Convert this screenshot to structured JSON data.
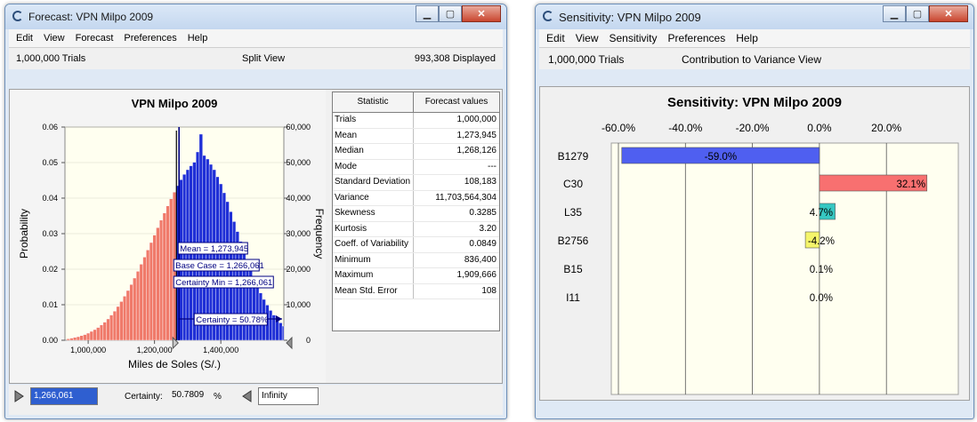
{
  "left": {
    "title": "Forecast: VPN Milpo 2009",
    "menu": [
      "Edit",
      "View",
      "Forecast",
      "Preferences",
      "Help"
    ],
    "trials_label": "1,000,000 Trials",
    "view_label": "Split View",
    "displayed_label": "993,308 Displayed",
    "chart_title": "VPN Milpo 2009",
    "xlabel": "Miles de Soles (S/.)",
    "ylabel_left": "Probability",
    "ylabel_right": "Frequency",
    "y_ticks_left": [
      "0.00",
      "0.01",
      "0.02",
      "0.03",
      "0.04",
      "0.05",
      "0.06"
    ],
    "y_ticks_right": [
      "0",
      "10,000",
      "20,000",
      "30,000",
      "40,000",
      "50,000",
      "60,000"
    ],
    "x_ticks": [
      "1,000,000",
      "1,200,000",
      "1,400,000"
    ],
    "annotations": {
      "mean": "Mean = 1,273,945",
      "base_case": "Base Case = 1,266,061",
      "certainty_min": "Certainty Min = 1,266,061",
      "certainty": "Certainty = 50.78%"
    },
    "stats_header": {
      "name": "Statistic",
      "value": "Forecast values"
    },
    "stats": [
      {
        "name": "Trials",
        "value": "1,000,000"
      },
      {
        "name": "Mean",
        "value": "1,273,945"
      },
      {
        "name": "Median",
        "value": "1,268,126"
      },
      {
        "name": "Mode",
        "value": "---"
      },
      {
        "name": "Standard Deviation",
        "value": "108,183"
      },
      {
        "name": "Variance",
        "value": "11,703,564,304"
      },
      {
        "name": "Skewness",
        "value": "0.3285"
      },
      {
        "name": "Kurtosis",
        "value": "3.20"
      },
      {
        "name": "Coeff. of Variability",
        "value": "0.0849"
      },
      {
        "name": "Minimum",
        "value": "836,400"
      },
      {
        "name": "Maximum",
        "value": "1,909,666"
      },
      {
        "name": "Mean Std. Error",
        "value": "108"
      }
    ],
    "bottom": {
      "lower_value": "1,266,061",
      "certainty_label": "Certainty:",
      "certainty_value": "50.7809",
      "percent": "%",
      "upper_value": "Infinity"
    },
    "colors": {
      "left_tail": "#f07a6a",
      "right_tail": "#1f2fd6",
      "plot_bg": "#fffff0"
    }
  },
  "right": {
    "title": "Sensitivity: VPN Milpo 2009",
    "menu": [
      "Edit",
      "View",
      "Sensitivity",
      "Preferences",
      "Help"
    ],
    "trials_label": "1,000,000 Trials",
    "view_label": "Contribution to Variance View",
    "chart_title": "Sensitivity: VPN Milpo 2009",
    "x_ticks": [
      "-60.0%",
      "-40.0%",
      "-20.0%",
      "0.0%",
      "20.0%"
    ]
  },
  "chart_data": [
    {
      "type": "bar",
      "title": "VPN Milpo 2009",
      "xlabel": "Miles de Soles (S/.)",
      "ylabel": "Probability",
      "xlim": [
        930000,
        1590000
      ],
      "ylim": [
        0,
        0.06
      ],
      "y2lim": [
        0,
        60000
      ],
      "certainty_min": 1266061,
      "mean": 1273945,
      "x_start": 935000,
      "bin_width": 10000,
      "values": [
        0.0004,
        0.0006,
        0.0008,
        0.001,
        0.0013,
        0.0016,
        0.002,
        0.0025,
        0.003,
        0.0036,
        0.0043,
        0.0051,
        0.006,
        0.0071,
        0.0082,
        0.0095,
        0.0109,
        0.0124,
        0.014,
        0.0157,
        0.0175,
        0.0194,
        0.0214,
        0.0234,
        0.0254,
        0.0275,
        0.0296,
        0.0317,
        0.0338,
        0.0358,
        0.0378,
        0.0398,
        0.0417,
        0.0435,
        0.0452,
        0.0467,
        0.048,
        0.0491,
        0.0501,
        0.053,
        0.058,
        0.052,
        0.051,
        0.0495,
        0.048,
        0.046,
        0.044,
        0.0415,
        0.039,
        0.0362,
        0.0334,
        0.0306,
        0.0278,
        0.025,
        0.0223,
        0.0198,
        0.0175,
        0.0153,
        0.0133,
        0.0115,
        0.0099,
        0.0084,
        0.0071,
        0.0059,
        0.0049,
        0.004
      ]
    },
    {
      "type": "bar",
      "orientation": "horizontal",
      "title": "Sensitivity: VPN Milpo 2009",
      "categories": [
        "B1279",
        "C30",
        "L35",
        "B2756",
        "B15",
        "I11"
      ],
      "values": [
        -59.0,
        32.1,
        4.7,
        -4.2,
        0.1,
        0.0
      ],
      "labels": [
        "-59.0%",
        "32.1%",
        "4.7%",
        "-4.2%",
        "0.1%",
        "0.0%"
      ],
      "colors": [
        "#4f5ff0",
        "#f87070",
        "#36c7c2",
        "#f5f56a",
        "#4f5ff0",
        "#4f5ff0"
      ],
      "xlim": [
        -60,
        30
      ],
      "grid": true
    }
  ]
}
